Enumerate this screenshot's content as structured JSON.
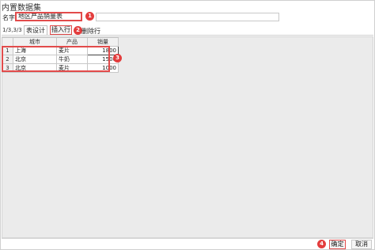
{
  "dialog": {
    "title": "内置数据集",
    "name_label": "名字",
    "name_value": "地区产品销量表",
    "pager": "1/3,3/3",
    "tab_design": "表设计",
    "insert_row": "插入行",
    "delete_row": "删除行",
    "ok": "确定",
    "cancel": "取消"
  },
  "badges": [
    "1",
    "2",
    "3",
    "4"
  ],
  "table": {
    "columns": [
      "城市",
      "产品",
      "销量"
    ],
    "rows": [
      {
        "num": "1",
        "city": "上海",
        "product": "麦片",
        "sales": "1800"
      },
      {
        "num": "2",
        "city": "北京",
        "product": "牛奶",
        "sales": "1500"
      },
      {
        "num": "3",
        "city": "北京",
        "product": "麦片",
        "sales": "1000"
      }
    ]
  },
  "colors": {
    "highlight": "#e24b4b",
    "badge": "#e33d3d"
  }
}
